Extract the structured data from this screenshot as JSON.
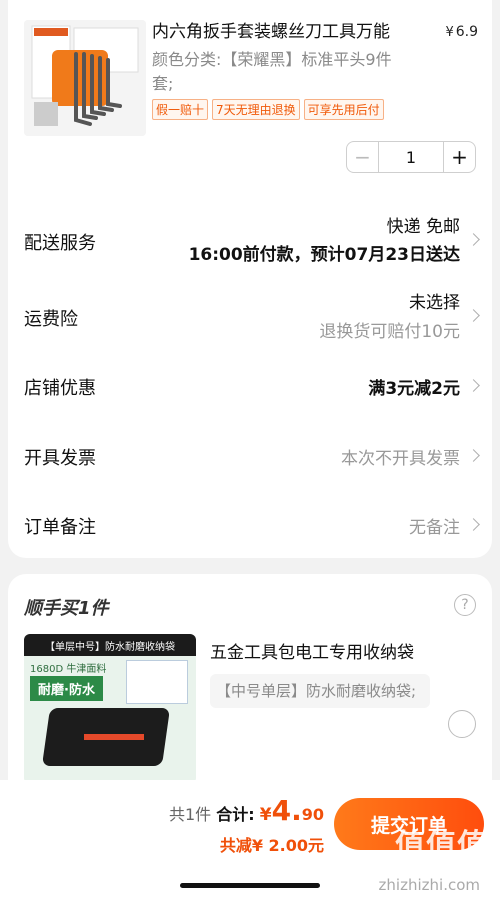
{
  "product": {
    "title": "内六角扳手套装螺丝刀工具万能",
    "price_symbol": "¥",
    "price": "6.9",
    "spec": "颜色分类:【荣耀黑】标准平头9件套;",
    "tags": [
      "假一赔十",
      "7天无理由退换",
      "可享先用后付"
    ],
    "quantity": "1",
    "minus": "−",
    "plus": "+"
  },
  "rows": {
    "delivery": {
      "label": "配送服务",
      "line1": "快递 免邮",
      "line2": "16:00前付款，预计07月23日送达"
    },
    "insurance": {
      "label": "运费险",
      "line1": "未选择",
      "line2": "退换货可赔付10元"
    },
    "coupon": {
      "label": "店铺优惠",
      "value": "满3元减2元"
    },
    "invoice": {
      "label": "开具发票",
      "value": "本次不开具发票"
    },
    "note": {
      "label": "订单备注",
      "value": "无备注"
    }
  },
  "addon": {
    "title": "顺手买1件",
    "help": "?",
    "image_header": "【单层中号】防水耐磨收纳袋",
    "image_spec": "1680D 牛津面料",
    "image_badge": "耐磨·防水",
    "name": "五金工具包电工专用收纳袋",
    "spec": "【中号单层】防水耐磨收纳袋;"
  },
  "footer": {
    "count": "共1件",
    "total_label": "合计:",
    "currency": "¥",
    "total_int": "4.",
    "total_dec": "90",
    "saving": "共减¥ 2.00元",
    "submit": "提交订单"
  },
  "watermark": {
    "text": "值值值",
    "url": "zhizhizhi.com"
  },
  "colors": {
    "accent": "#ff5a0f",
    "tag_border": "#f7b186",
    "text_gray": "#999999"
  }
}
